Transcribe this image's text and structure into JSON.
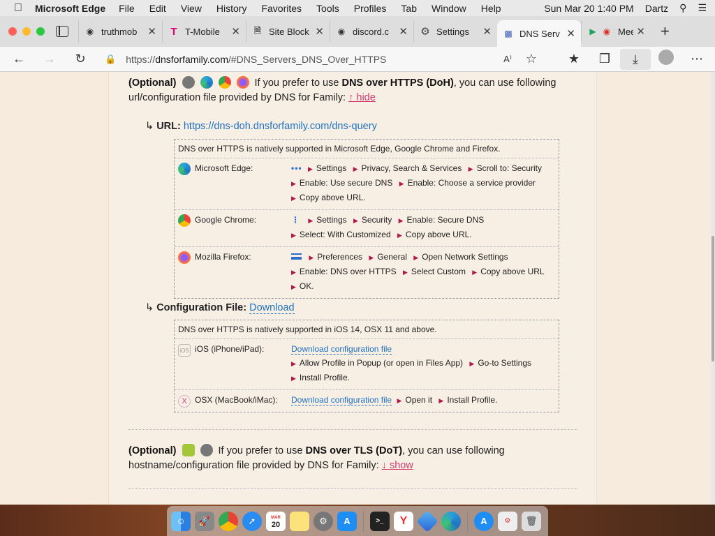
{
  "menubar": {
    "app_name": "Microsoft Edge",
    "items": [
      "File",
      "Edit",
      "View",
      "History",
      "Favorites",
      "Tools",
      "Profiles",
      "Tab",
      "Window",
      "Help"
    ],
    "clock": "Sun Mar 20  1:40 PM",
    "user": "Dartz"
  },
  "tabs": [
    {
      "label": "truthmob",
      "icon": "discord-icon",
      "active": false
    },
    {
      "label": "T-Mobile",
      "icon": "tmobile-icon",
      "active": false
    },
    {
      "label": "Site Block",
      "icon": "page-icon",
      "active": false
    },
    {
      "label": "discord.c",
      "icon": "discord-icon",
      "active": false
    },
    {
      "label": "Settings",
      "icon": "gear-icon",
      "active": false
    },
    {
      "label": "DNS Serv",
      "icon": "dns-icon",
      "active": true
    },
    {
      "label": "Mee",
      "icon": "meet-icon",
      "active": false
    }
  ],
  "address": {
    "prefix": "https://",
    "domain": "dnsforfamily.com",
    "path": "/#DNS_Servers_DNS_Over_HTTPS"
  },
  "doh": {
    "optional": "(Optional)",
    "text_before": "If you prefer to use",
    "bold": "DNS over HTTPS (DoH)",
    "text_after": ", you can use following url/configuration file provided by DNS for Family:",
    "toggle": "↑ hide",
    "url_label": "URL:",
    "url": "https://dns-doh.dnsforfamily.com/dns-query",
    "browser_intro": "DNS over HTTPS is natively supported in Microsoft Edge, Google Chrome and Firefox.",
    "browsers": [
      {
        "name": "Microsoft Edge:",
        "menu": "dots",
        "steps": [
          "Settings",
          "Privacy, Search & Services",
          "Scroll to: Security",
          "Enable: Use secure DNS",
          "Enable: Choose a service provider",
          "Copy above URL."
        ]
      },
      {
        "name": "Google Chrome:",
        "menu": "vdots",
        "steps": [
          "Settings",
          "Security",
          "Enable: Secure DNS",
          "Select: With Customized",
          "Copy above URL."
        ]
      },
      {
        "name": "Mozilla Firefox:",
        "menu": "hamburger",
        "steps": [
          "Preferences",
          "General",
          "Open Network Settings",
          "Enable: DNS over HTTPS",
          "Select Custom",
          "Copy above URL",
          "OK."
        ]
      }
    ],
    "config_label": "Configuration File:",
    "config_link": "Download",
    "os_intro": "DNS over HTTPS is natively supported in iOS 14, OSX 11 and above.",
    "ios": {
      "name": "iOS (iPhone/iPad):",
      "link": "Download configuration file",
      "steps": [
        "Allow Profile in Popup (or open in Files App)",
        "Go-to Settings",
        "Install Profile."
      ]
    },
    "osx": {
      "name": "OSX (MacBook/iMac):",
      "link": "Download configuration file",
      "steps": [
        "Open it",
        "Install Profile."
      ]
    }
  },
  "dot": {
    "optional": "(Optional)",
    "text_before": "If you prefer to use",
    "bold": "DNS over TLS (DoT)",
    "text_after": ", you can use following hostname/configuration file provided by DNS for Family:",
    "toggle": "↓ show"
  },
  "dock": [
    "Finder",
    "Launchpad",
    "Chrome",
    "Safari",
    "Calendar",
    "Notes",
    "System Preferences",
    "App Store",
    "Terminal",
    "Yandex",
    "Edge Dev",
    "Edge",
    "App Store",
    "Font Book",
    "Trash"
  ],
  "calendar": {
    "month": "MAR",
    "day": "20"
  }
}
